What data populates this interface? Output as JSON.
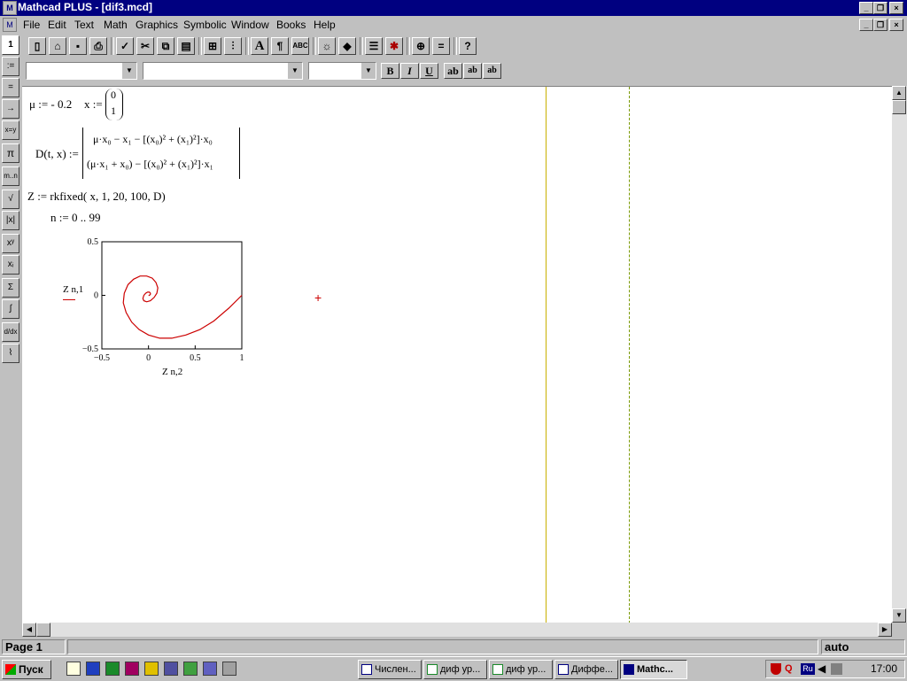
{
  "window": {
    "title": "Mathcad PLUS - [dif3.mcd]",
    "app_icon": "mathcad-icon",
    "controls": [
      "_",
      "❐",
      "×"
    ]
  },
  "menu": [
    "File",
    "Edit",
    "Text",
    "Math",
    "Graphics",
    "Symbolic",
    "Window",
    "Books",
    "Help"
  ],
  "toolbar": {
    "buttons": [
      "new-icon",
      "open-icon",
      "save-icon",
      "print-icon",
      "check-icon",
      "cut-icon",
      "copy-icon",
      "paste-icon",
      "insert-icon",
      "align-icon",
      "text-icon",
      "paragraph-icon",
      "spellcheck-icon",
      "lightbulb-icon",
      "resource-icon",
      "region-icon",
      "maple-icon",
      "zoom-icon",
      "calculate-icon",
      "help-icon"
    ]
  },
  "format_bar": {
    "style_value": "",
    "font_value": "",
    "size_value": "",
    "bold": "B",
    "italic": "I",
    "underline": "U",
    "sup_labels": [
      "ab",
      "ab",
      "ab"
    ]
  },
  "palette": [
    "1",
    ":=",
    "=",
    "→",
    "x=y",
    "π",
    "m..n",
    "√",
    "|x|",
    "xʸ",
    "xᵢ",
    "Σ",
    "∫",
    "d/dx",
    "⌇"
  ],
  "worksheet": {
    "mu_def": "μ := - 0.2",
    "x_def_lhs": "x :=",
    "x_vector": [
      "0",
      "1"
    ],
    "d_def_lhs": "D(t, x) :=",
    "d_row1": "μ·x₀ − x₁ − [(x₀)² + (x₁)²]·x₀",
    "d_row2": "(μ·x₁ + x₀) − [(x₀)² + (x₁)²]·x₁",
    "z_def": "Z := rkfixed( x, 1, 20, 100, D)",
    "n_def": "n := 0 .. 99",
    "cursor": "+"
  },
  "chart_data": {
    "type": "line",
    "title": "",
    "xlabel": "Z n,2",
    "ylabel": "Z n,1",
    "xlim": [
      -0.5,
      1
    ],
    "ylim": [
      -0.5,
      0.5
    ],
    "x_ticks": [
      "−0.5",
      "0",
      "0.5",
      "1"
    ],
    "y_ticks": [
      "0.5",
      "0",
      "−0.5"
    ],
    "series": [
      {
        "color": "#cc0000",
        "x": [
          1.0,
          0.86,
          0.7,
          0.55,
          0.4,
          0.25,
          0.12,
          0.0,
          -0.1,
          -0.18,
          -0.24,
          -0.27,
          -0.26,
          -0.22,
          -0.16,
          -0.09,
          -0.02,
          0.04,
          0.08,
          0.1,
          0.09,
          0.06,
          0.02,
          -0.02,
          -0.05,
          -0.06,
          -0.05,
          -0.03,
          -0.01,
          0.01,
          0.02,
          0.02,
          0.01,
          0.0
        ],
        "y": [
          0.0,
          -0.12,
          -0.24,
          -0.32,
          -0.37,
          -0.4,
          -0.4,
          -0.37,
          -0.32,
          -0.25,
          -0.16,
          -0.07,
          0.02,
          0.1,
          0.15,
          0.18,
          0.18,
          0.16,
          0.12,
          0.07,
          0.02,
          -0.02,
          -0.05,
          -0.06,
          -0.05,
          -0.03,
          0.0,
          0.02,
          0.03,
          0.03,
          0.02,
          0.01,
          0.0,
          0.0
        ]
      }
    ],
    "grid": false
  },
  "status": {
    "page": "Page 1",
    "mode": "auto"
  },
  "taskbar": {
    "start_label": "Пуск",
    "tasks": [
      "Числен...",
      "диф ур...",
      "диф ур...",
      "Диффе...",
      "Mathc..."
    ],
    "time": "17:00",
    "lang": "Ru"
  }
}
